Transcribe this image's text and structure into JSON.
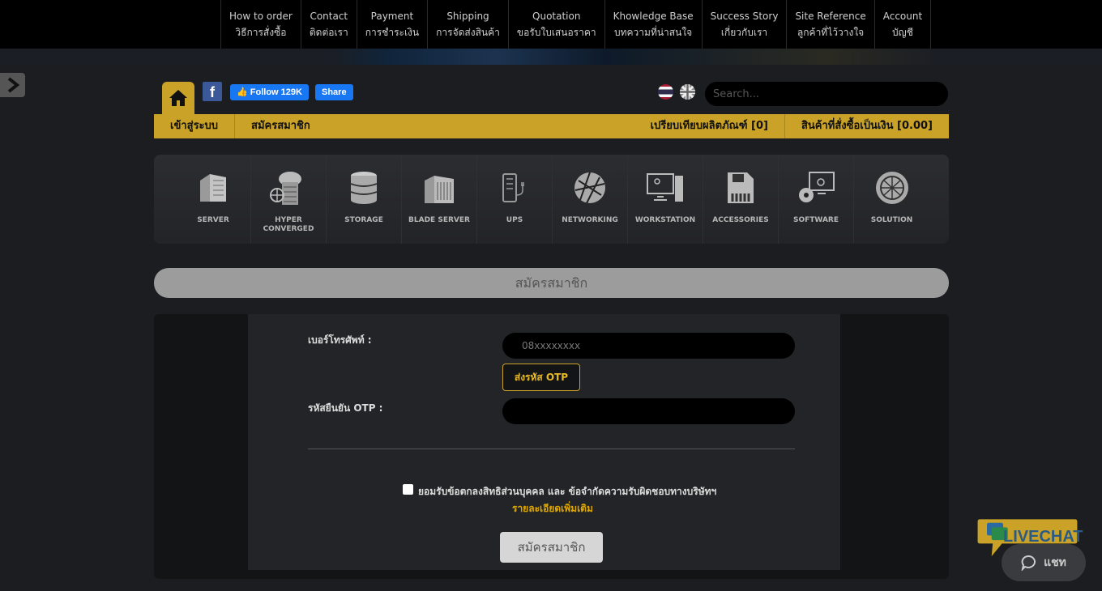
{
  "topnav": [
    {
      "en": "How to order",
      "th": "วิธีการสั่งซื้อ"
    },
    {
      "en": "Contact",
      "th": "ติดต่อเรา"
    },
    {
      "en": "Payment",
      "th": "การชำระเงิน"
    },
    {
      "en": "Shipping",
      "th": "การจัดส่งสินค้า"
    },
    {
      "en": "Quotation",
      "th": "ขอรับใบเสนอราคา"
    },
    {
      "en": "Khowledge Base",
      "th": "บทความที่น่าสนใจ"
    },
    {
      "en": "Success Story",
      "th": "เกี่ยวกับเรา"
    },
    {
      "en": "Site Reference",
      "th": "ลูกค้าที่ไว้วางใจ"
    },
    {
      "en": "Account",
      "th": "บัญชี"
    }
  ],
  "social": {
    "fb_letter": "f",
    "follow": "Follow 129K",
    "share": "Share"
  },
  "search": {
    "placeholder": "Search..."
  },
  "goldbar": {
    "login": "เข้าสู่ระบบ",
    "register": "สมัครสมาชิก",
    "compare": "เปรียบเทียบผลิตภัณฑ์ [0]",
    "cart": "สินค้าที่สั่งซื้อเป็นเงิน [0.00]"
  },
  "categories": [
    {
      "label": "SERVER",
      "icon": "server-icon"
    },
    {
      "label": "HYPER CONVERGED",
      "icon": "hyper-converged-icon"
    },
    {
      "label": "STORAGE",
      "icon": "storage-icon"
    },
    {
      "label": "BLADE SERVER",
      "icon": "blade-server-icon"
    },
    {
      "label": "UPS",
      "icon": "ups-icon"
    },
    {
      "label": "NETWORKING",
      "icon": "networking-icon"
    },
    {
      "label": "WORKSTATION",
      "icon": "workstation-icon"
    },
    {
      "label": "ACCESSORIES",
      "icon": "accessories-icon"
    },
    {
      "label": "SOFTWARE",
      "icon": "software-icon"
    },
    {
      "label": "SOLUTION",
      "icon": "solution-icon"
    }
  ],
  "section_title": "สมัครสมาชิก",
  "form": {
    "phone_label": "เบอร์โทรศัพท์ :",
    "phone_placeholder": "08xxxxxxxx",
    "otp_button": "ส่งรหัส OTP",
    "otp_label": "รหัสยืนยัน OTP :",
    "otp_placeholder": "",
    "consent": "ยอมรับข้อตกลงสิทธิส่วนบุคคล และ ข้อจำกัดความรับผิดชอบทางบริษัทฯ",
    "more": "รายละเอียดเพิ่มเติม",
    "submit": "สมัครสมาชิก"
  },
  "livechat": {
    "brand": "LIVECHAT",
    "chat": "แชท"
  },
  "colors": {
    "gold": "#c9a227",
    "bg": "#1c1d20",
    "panel": "#232427"
  }
}
